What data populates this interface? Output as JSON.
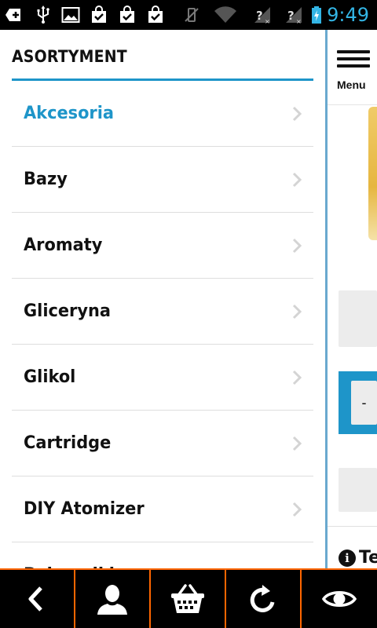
{
  "status_bar": {
    "time": "9:49",
    "icons": [
      "add-notification-icon",
      "usb-icon",
      "image-icon",
      "checked-bag-icon",
      "checked-bag-icon",
      "checked-bag-icon",
      "vibrate-off-icon",
      "wifi-icon",
      "signal-unknown-icon",
      "signal-unknown-icon",
      "battery-charging-icon"
    ],
    "clock_color": "#33b5e5"
  },
  "drawer": {
    "title": "ASORTYMENT",
    "accent_color": "#1e95c9",
    "items": [
      {
        "label": "Akcesoria",
        "active": true
      },
      {
        "label": "Bazy",
        "active": false
      },
      {
        "label": "Aromaty",
        "active": false
      },
      {
        "label": "Gliceryna",
        "active": false
      },
      {
        "label": "Glikol",
        "active": false
      },
      {
        "label": "Cartridge",
        "active": false
      },
      {
        "label": "DIY Atomizer",
        "active": false
      },
      {
        "label": "Pojemniki",
        "active": false
      }
    ]
  },
  "right_panel": {
    "menu_label": "Menu",
    "minus_label": "-",
    "info_text": "Te"
  },
  "bottom_bar": {
    "accent_color": "#ff6600",
    "buttons": [
      "back-icon",
      "user-icon",
      "basket-icon",
      "refresh-icon",
      "eye-icon"
    ]
  }
}
